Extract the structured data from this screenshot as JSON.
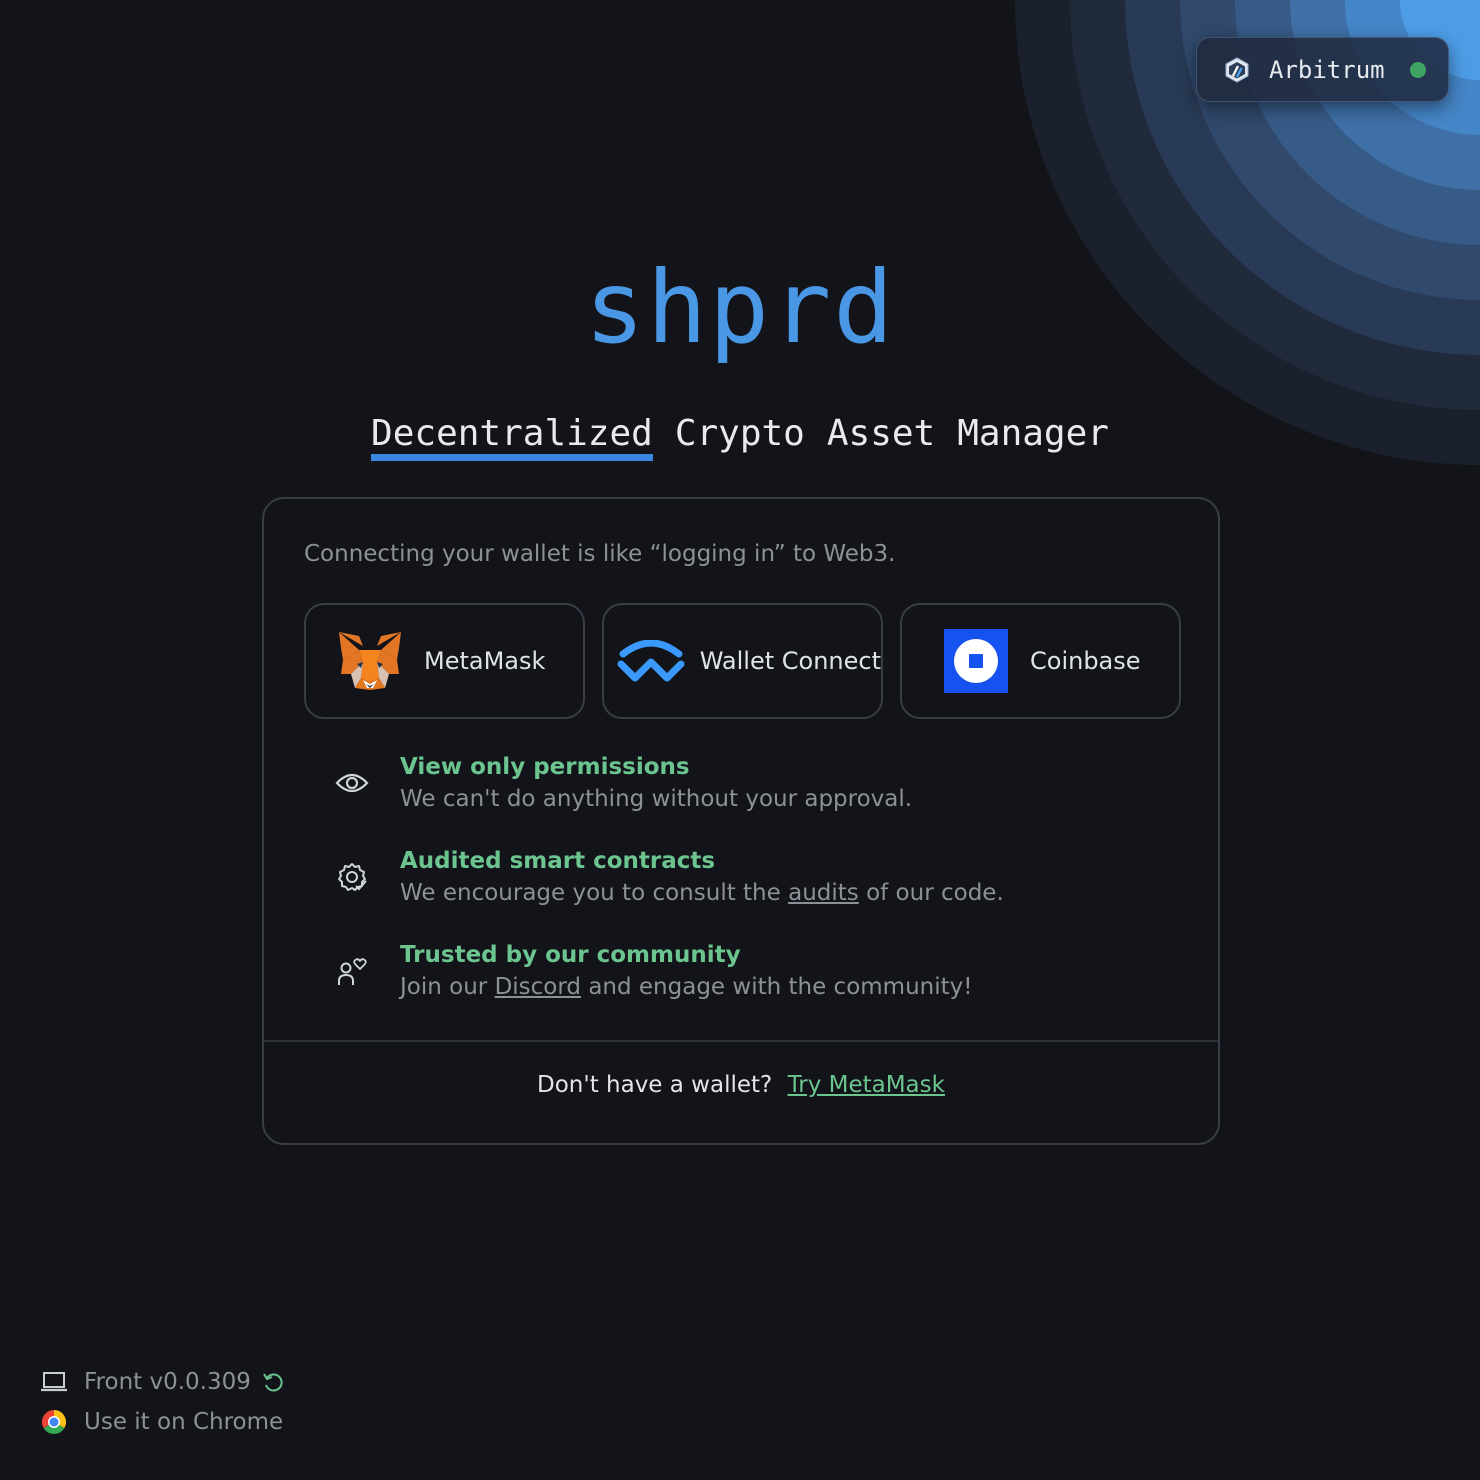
{
  "network": {
    "name": "Arbitrum",
    "status_color": "#3fa463",
    "icon": "arbitrum-icon"
  },
  "brand": {
    "logo_text": "shprd",
    "tagline_words": [
      "Decentralized",
      "Crypto",
      "Asset",
      "Manager"
    ],
    "accent_color": "#4a97e6"
  },
  "card": {
    "intro": "Connecting your wallet is like “logging in” to Web3.",
    "wallets": [
      {
        "label": "MetaMask",
        "icon": "metamask-fox-icon"
      },
      {
        "label": "Wallet Connect",
        "icon": "walletconnect-icon"
      },
      {
        "label": "Coinbase",
        "icon": "coinbase-icon"
      }
    ],
    "features": [
      {
        "title": "View only permissions",
        "desc": "We can't do anything without your approval.",
        "icon": "eye-icon"
      },
      {
        "title": "Audited smart contracts",
        "desc_before": "We encourage you to consult the",
        "desc_link": "audits",
        "desc_after": "of our code.",
        "icon": "gear-check-icon"
      },
      {
        "title": "Trusted by our community",
        "desc_before": "Join our",
        "desc_link": "Discord",
        "desc_after": "and engage with the community!",
        "icon": "user-heart-icon"
      }
    ],
    "footer_text": "Don't have a wallet?",
    "footer_link": "Try MetaMask",
    "highlight_color": "#6cc48f"
  },
  "bottom": {
    "version": "Front v0.0.309",
    "chrome_text": "Use it on Chrome"
  }
}
